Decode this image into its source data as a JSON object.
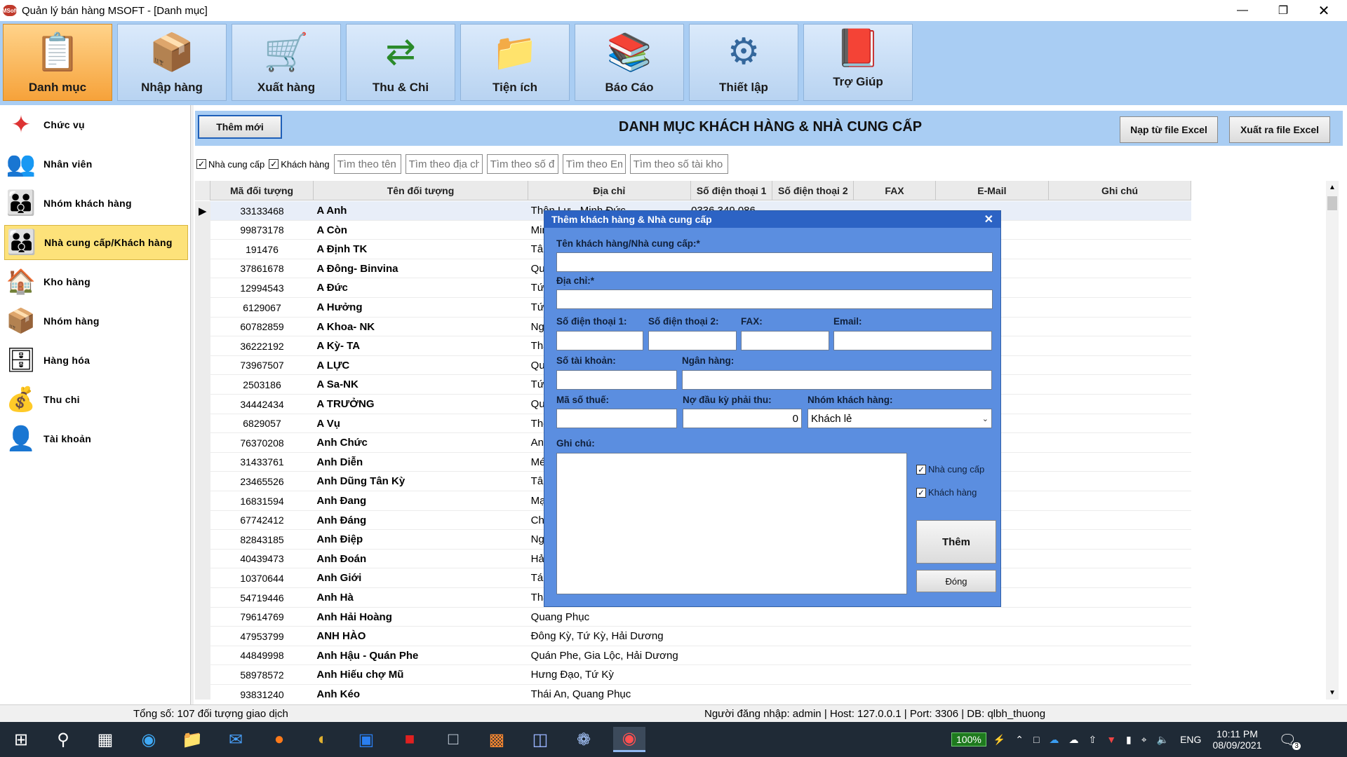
{
  "window": {
    "title": "Quản lý bán hàng MSOFT - [Danh mục]",
    "app_icon": "MSoft"
  },
  "ribbon": {
    "buttons": [
      {
        "label": "Danh mục",
        "icon": "catalog-icon",
        "active": true
      },
      {
        "label": "Nhập hàng",
        "icon": "handtruck-icon"
      },
      {
        "label": "Xuất hàng",
        "icon": "cart-icon"
      },
      {
        "label": "Thu & Chi",
        "icon": "money-arrows-icon"
      },
      {
        "label": "Tiện ích",
        "icon": "tools-folder-icon"
      },
      {
        "label": "Báo Cáo",
        "icon": "report-books-icon"
      },
      {
        "label": "Thiết lập",
        "icon": "gear-icon"
      },
      {
        "label": "Trợ Giúp",
        "icon": "help-book-icon"
      }
    ]
  },
  "sidebar": {
    "items": [
      {
        "label": "Chức vụ",
        "icon": "puzzle-icon"
      },
      {
        "label": "Nhân viên",
        "icon": "staff-icon"
      },
      {
        "label": "Nhóm khách hàng",
        "icon": "customer-group-icon"
      },
      {
        "label": "Nhà cung cấp/Khách hàng",
        "icon": "supplier-icon",
        "active": true
      },
      {
        "label": "Kho hàng",
        "icon": "warehouse-icon"
      },
      {
        "label": "Nhóm hàng",
        "icon": "box-stack-icon"
      },
      {
        "label": "Hàng hóa",
        "icon": "goods-icon"
      },
      {
        "label": "Thu chi",
        "icon": "cash-jar-icon"
      },
      {
        "label": "Tài khoản",
        "icon": "account-icon"
      }
    ]
  },
  "main": {
    "add_button": "Thêm mới",
    "title": "DANH MỤC KHÁCH HÀNG & NHÀ CUNG CẤP",
    "import_excel": "Nạp từ file Excel",
    "export_excel": "Xuất ra file Excel",
    "filters": {
      "supplier_label": "Nhà cung cấp",
      "customer_label": "Khách hàng",
      "search_name": "Tìm theo tên",
      "search_address": "Tìm theo địa chỉ",
      "search_phone": "Tìm theo số đ",
      "search_email": "Tìm theo Em",
      "search_account": "Tìm theo số tài kho"
    },
    "columns": [
      "Mã đối tượng",
      "Tên đối tượng",
      "Địa chỉ",
      "Số điện thoại 1",
      "Số điện thoại 2",
      "FAX",
      "E-Mail",
      "Ghi chú"
    ],
    "rows": [
      [
        "33133468",
        "A Anh",
        "Thôn Lư - Minh Đức",
        "0336 349 086"
      ],
      [
        "99873178",
        "A Còn",
        "Minh",
        ""
      ],
      [
        "191476",
        "A Định TK",
        "Tân",
        ""
      ],
      [
        "37861678",
        "A Đông- Binvina",
        "Quan",
        ""
      ],
      [
        "12994543",
        "A Đức",
        "Tứ K",
        ""
      ],
      [
        "6129067",
        "A Hưởng",
        "Tứ K",
        ""
      ],
      [
        "60782859",
        "A Khoa- NK",
        "Ngọc",
        ""
      ],
      [
        "36222192",
        "A Kỳ- TA",
        "Thái",
        ""
      ],
      [
        "73967507",
        "A LỰC",
        "Quan",
        ""
      ],
      [
        "2503186",
        "A Sa-NK",
        "Tứ K",
        ""
      ],
      [
        "34442434",
        "A TRƯỞNG",
        "Quan",
        ""
      ],
      [
        "6829057",
        "A Vụ",
        "Thôn",
        ""
      ],
      [
        "76370208",
        "Anh Chức",
        "An P",
        ""
      ],
      [
        "31433761",
        "Anh Diễn",
        "Mép",
        ""
      ],
      [
        "23465526",
        "Anh Dũng Tân Kỳ",
        "Tân",
        ""
      ],
      [
        "16831594",
        "Anh Đang",
        "Mạc",
        ""
      ],
      [
        "67742412",
        "Anh Đáng",
        "Chợ",
        ""
      ],
      [
        "82843185",
        "Anh Điệp",
        "Ngã",
        ""
      ],
      [
        "40439473",
        "Anh Đoán",
        "Hải D",
        ""
      ],
      [
        "10370644",
        "Anh Giới",
        "Tái S",
        ""
      ],
      [
        "54719446",
        "Anh Hà",
        "Thái",
        ""
      ],
      [
        "79614769",
        "Anh Hải Hoàng",
        "Quang Phục",
        ""
      ],
      [
        "47953799",
        "ANH HÀO",
        "Đông Kỳ, Tứ Kỳ, Hải Dương",
        ""
      ],
      [
        "44849998",
        "Anh Hậu - Quán Phe",
        "Quán Phe, Gia Lộc, Hải Dương",
        ""
      ],
      [
        "58978572",
        "Anh Hiếu chợ Mũ",
        "Hưng Đạo, Tứ Kỳ",
        ""
      ],
      [
        "93831240",
        "Anh Kéo",
        "Thái An, Quang Phục",
        ""
      ]
    ]
  },
  "status": {
    "total": "Tổng số: 107 đối tượng giao dịch",
    "login": "Người đăng nhập: admin | Host: 127.0.0.1 | Port: 3306 | DB: qlbh_thuong"
  },
  "dialog": {
    "title": "Thêm khách hàng & Nhà cung cấp",
    "name_label": "Tên khách hàng/Nhà cung cấp:*",
    "address_label": "Địa chỉ:*",
    "phone1_label": "Số điện thoại 1:",
    "phone2_label": "Số điện thoại 2:",
    "fax_label": "FAX:",
    "email_label": "Email:",
    "account_label": "Số tài khoản:",
    "bank_label": "Ngân hàng:",
    "tax_label": "Mã số thuế:",
    "debt_label": "Nợ đầu kỳ phải thu:",
    "debt_value": "0",
    "group_label": "Nhóm khách hàng:",
    "group_value": "Khách lẻ",
    "note_label": "Ghi chú:",
    "chk_supplier": "Nhà cung cấp",
    "chk_customer": "Khách hàng",
    "add_button": "Thêm",
    "close_button": "Đóng"
  },
  "taskbar": {
    "battery": "100%",
    "lang": "ENG",
    "time": "10:11 PM",
    "date": "08/09/2021",
    "notifications": "3"
  }
}
